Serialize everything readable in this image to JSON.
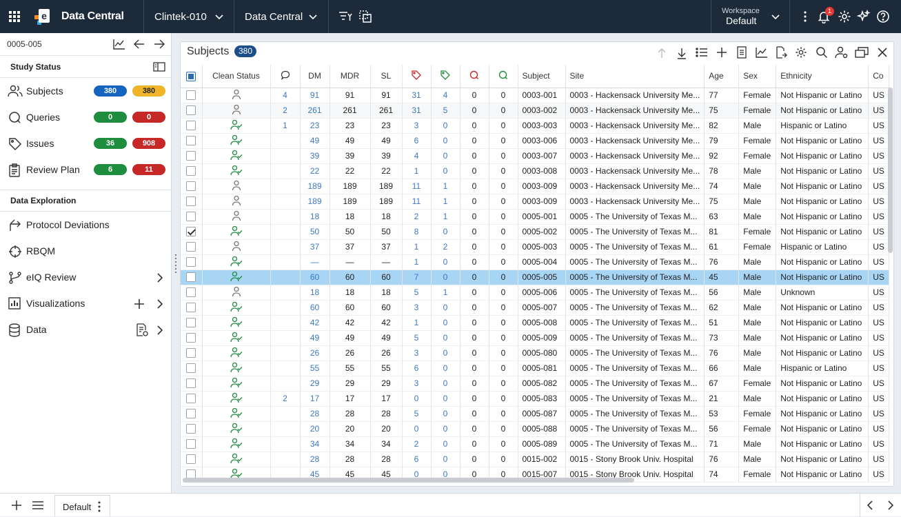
{
  "app": {
    "title": "Data Central"
  },
  "topbar": {
    "study": "Clintek-010",
    "module": "Data Central",
    "workspace_label": "Workspace",
    "workspace_value": "Default",
    "notif_count": "1"
  },
  "sidebar": {
    "subject_id": "0005-005",
    "study_status_title": "Study Status",
    "status_items": [
      {
        "label": "Subjects",
        "a": "380",
        "b": "380",
        "a_color": "#1565c0",
        "b_color": "#f0b429"
      },
      {
        "label": "Queries",
        "a": "0",
        "b": "0",
        "a_color": "#1e8e3e",
        "b_color": "#c62828"
      },
      {
        "label": "Issues",
        "a": "36",
        "b": "908",
        "a_color": "#1e8e3e",
        "b_color": "#c62828"
      },
      {
        "label": "Review Plan",
        "a": "6",
        "b": "11",
        "a_color": "#1e8e3e",
        "b_color": "#c62828"
      }
    ],
    "data_exploration_title": "Data Exploration",
    "explore_items": [
      "Protocol Deviations",
      "RBQM",
      "eIQ Review",
      "Visualizations",
      "Data"
    ]
  },
  "panel": {
    "title": "Subjects",
    "count": "380",
    "columns": [
      "Clean Status",
      "DM",
      "MDR",
      "SL",
      "Subject",
      "Site",
      "Age",
      "Sex",
      "Ethnicity",
      "Co"
    ],
    "rows": [
      {
        "chk": false,
        "clean": false,
        "cmt": "4",
        "dm": "91",
        "mdr": "91",
        "sl": "91",
        "tr": "31",
        "tg": "4",
        "qr": "0",
        "qg": "0",
        "subject": "0003-001",
        "site": "0003 - Hackensack University Me...",
        "age": "77",
        "sex": "Female",
        "eth": "Not Hispanic or Latino",
        "co": "US"
      },
      {
        "chk": false,
        "clean": false,
        "cmt": "2",
        "dm": "261",
        "mdr": "261",
        "sl": "261",
        "tr": "31",
        "tg": "5",
        "qr": "0",
        "qg": "0",
        "subject": "0003-002",
        "site": "0003 - Hackensack University Me...",
        "age": "75",
        "sex": "Female",
        "eth": "Not Hispanic or Latino",
        "co": "US"
      },
      {
        "chk": false,
        "clean": true,
        "cmt": "1",
        "dm": "23",
        "mdr": "23",
        "sl": "23",
        "tr": "3",
        "tg": "0",
        "qr": "0",
        "qg": "0",
        "subject": "0003-003",
        "site": "0003 - Hackensack University Me...",
        "age": "82",
        "sex": "Male",
        "eth": "Hispanic or Latino",
        "co": "US"
      },
      {
        "chk": false,
        "clean": true,
        "cmt": "",
        "dm": "49",
        "mdr": "49",
        "sl": "49",
        "tr": "6",
        "tg": "0",
        "qr": "0",
        "qg": "0",
        "subject": "0003-006",
        "site": "0003 - Hackensack University Me...",
        "age": "79",
        "sex": "Female",
        "eth": "Not Hispanic or Latino",
        "co": "US"
      },
      {
        "chk": false,
        "clean": true,
        "cmt": "",
        "dm": "39",
        "mdr": "39",
        "sl": "39",
        "tr": "4",
        "tg": "0",
        "qr": "0",
        "qg": "0",
        "subject": "0003-007",
        "site": "0003 - Hackensack University Me...",
        "age": "92",
        "sex": "Female",
        "eth": "Not Hispanic or Latino",
        "co": "US"
      },
      {
        "chk": false,
        "clean": true,
        "cmt": "",
        "dm": "22",
        "mdr": "22",
        "sl": "22",
        "tr": "1",
        "tg": "0",
        "qr": "0",
        "qg": "0",
        "subject": "0003-008",
        "site": "0003 - Hackensack University Me...",
        "age": "78",
        "sex": "Male",
        "eth": "Not Hispanic or Latino",
        "co": "US"
      },
      {
        "chk": false,
        "clean": false,
        "cmt": "",
        "dm": "189",
        "mdr": "189",
        "sl": "189",
        "tr": "11",
        "tg": "1",
        "qr": "0",
        "qg": "0",
        "subject": "0003-009",
        "site": "0003 - Hackensack University Me...",
        "age": "74",
        "sex": "Male",
        "eth": "Not Hispanic or Latino",
        "co": "US"
      },
      {
        "chk": false,
        "clean": false,
        "cmt": "",
        "dm": "189",
        "mdr": "189",
        "sl": "189",
        "tr": "11",
        "tg": "1",
        "qr": "0",
        "qg": "0",
        "subject": "0003-009",
        "site": "0003 - Hackensack University Me...",
        "age": "75",
        "sex": "Male",
        "eth": "Not Hispanic or Latino",
        "co": "US"
      },
      {
        "chk": false,
        "clean": false,
        "cmt": "",
        "dm": "18",
        "mdr": "18",
        "sl": "18",
        "tr": "2",
        "tg": "1",
        "qr": "0",
        "qg": "0",
        "subject": "0005-001",
        "site": "0005 - The University of Texas M...",
        "age": "63",
        "sex": "Male",
        "eth": "Not Hispanic or Latino",
        "co": "US"
      },
      {
        "chk": true,
        "clean": true,
        "cmt": "",
        "dm": "50",
        "mdr": "50",
        "sl": "50",
        "tr": "8",
        "tg": "0",
        "qr": "0",
        "qg": "0",
        "subject": "0005-002",
        "site": "0005 - The University of Texas M...",
        "age": "81",
        "sex": "Female",
        "eth": "Not Hispanic or Latino",
        "co": "US"
      },
      {
        "chk": false,
        "clean": false,
        "cmt": "",
        "dm": "37",
        "mdr": "37",
        "sl": "37",
        "tr": "1",
        "tg": "2",
        "qr": "0",
        "qg": "0",
        "subject": "0005-003",
        "site": "0005 - The University of Texas M...",
        "age": "61",
        "sex": "Female",
        "eth": "Hispanic or Latino",
        "co": "US"
      },
      {
        "chk": false,
        "clean": true,
        "cmt": "",
        "dm": "—",
        "mdr": "—",
        "sl": "—",
        "tr": "1",
        "tg": "0",
        "qr": "0",
        "qg": "0",
        "subject": "0005-004",
        "site": "0005 - The University of Texas M...",
        "age": "76",
        "sex": "Male",
        "eth": "Not Hispanic or Latino",
        "co": "US"
      },
      {
        "chk": false,
        "clean": true,
        "cmt": "",
        "dm": "60",
        "mdr": "60",
        "sl": "60",
        "tr": "7",
        "tg": "0",
        "qr": "0",
        "qg": "0",
        "subject": "0005-005",
        "site": "0005 - The University of Texas M...",
        "age": "45",
        "sex": "Male",
        "eth": "Not Hispanic or Latino",
        "co": "US",
        "sel": true
      },
      {
        "chk": false,
        "clean": false,
        "cmt": "",
        "dm": "18",
        "mdr": "18",
        "sl": "18",
        "tr": "5",
        "tg": "1",
        "qr": "0",
        "qg": "0",
        "subject": "0005-006",
        "site": "0005 - The University of Texas M...",
        "age": "56",
        "sex": "Male",
        "eth": "Unknown",
        "co": "US"
      },
      {
        "chk": false,
        "clean": true,
        "cmt": "",
        "dm": "60",
        "mdr": "60",
        "sl": "60",
        "tr": "3",
        "tg": "0",
        "qr": "0",
        "qg": "0",
        "subject": "0005-007",
        "site": "0005 - The University of Texas M...",
        "age": "62",
        "sex": "Male",
        "eth": "Not Hispanic or Latino",
        "co": "US"
      },
      {
        "chk": false,
        "clean": true,
        "cmt": "",
        "dm": "42",
        "mdr": "42",
        "sl": "42",
        "tr": "1",
        "tg": "0",
        "qr": "0",
        "qg": "0",
        "subject": "0005-008",
        "site": "0005 - The University of Texas M...",
        "age": "51",
        "sex": "Male",
        "eth": "Not Hispanic or Latino",
        "co": "US"
      },
      {
        "chk": false,
        "clean": true,
        "cmt": "",
        "dm": "49",
        "mdr": "49",
        "sl": "49",
        "tr": "5",
        "tg": "0",
        "qr": "0",
        "qg": "0",
        "subject": "0005-009",
        "site": "0005 - The University of Texas M...",
        "age": "73",
        "sex": "Male",
        "eth": "Not Hispanic or Latino",
        "co": "US"
      },
      {
        "chk": false,
        "clean": true,
        "cmt": "",
        "dm": "26",
        "mdr": "26",
        "sl": "26",
        "tr": "3",
        "tg": "0",
        "qr": "0",
        "qg": "0",
        "subject": "0005-080",
        "site": "0005 - The University of Texas M...",
        "age": "76",
        "sex": "Male",
        "eth": "Not Hispanic or Latino",
        "co": "US"
      },
      {
        "chk": false,
        "clean": true,
        "cmt": "",
        "dm": "55",
        "mdr": "55",
        "sl": "55",
        "tr": "6",
        "tg": "0",
        "qr": "0",
        "qg": "0",
        "subject": "0005-081",
        "site": "0005 - The University of Texas M...",
        "age": "66",
        "sex": "Male",
        "eth": "Hispanic or Latino",
        "co": "US"
      },
      {
        "chk": false,
        "clean": true,
        "cmt": "",
        "dm": "29",
        "mdr": "29",
        "sl": "29",
        "tr": "3",
        "tg": "0",
        "qr": "0",
        "qg": "0",
        "subject": "0005-082",
        "site": "0005 - The University of Texas M...",
        "age": "67",
        "sex": "Female",
        "eth": "Not Hispanic or Latino",
        "co": "US"
      },
      {
        "chk": false,
        "clean": true,
        "cmt": "2",
        "dm": "17",
        "mdr": "17",
        "sl": "17",
        "tr": "0",
        "tg": "0",
        "qr": "0",
        "qg": "0",
        "subject": "0005-083",
        "site": "0005 - The University of Texas M...",
        "age": "21",
        "sex": "Male",
        "eth": "Not Hispanic or Latino",
        "co": "US"
      },
      {
        "chk": false,
        "clean": true,
        "cmt": "",
        "dm": "28",
        "mdr": "28",
        "sl": "28",
        "tr": "5",
        "tg": "0",
        "qr": "0",
        "qg": "0",
        "subject": "0005-087",
        "site": "0005 - The University of Texas M...",
        "age": "53",
        "sex": "Female",
        "eth": "Not Hispanic or Latino",
        "co": "US"
      },
      {
        "chk": false,
        "clean": true,
        "cmt": "",
        "dm": "20",
        "mdr": "20",
        "sl": "20",
        "tr": "0",
        "tg": "0",
        "qr": "0",
        "qg": "0",
        "subject": "0005-088",
        "site": "0005 - The University of Texas M...",
        "age": "56",
        "sex": "Female",
        "eth": "Not Hispanic or Latino",
        "co": "US"
      },
      {
        "chk": false,
        "clean": true,
        "cmt": "",
        "dm": "34",
        "mdr": "34",
        "sl": "34",
        "tr": "2",
        "tg": "0",
        "qr": "0",
        "qg": "0",
        "subject": "0005-089",
        "site": "0005 - The University of Texas M...",
        "age": "71",
        "sex": "Male",
        "eth": "Not Hispanic or Latino",
        "co": "US"
      },
      {
        "chk": false,
        "clean": true,
        "cmt": "",
        "dm": "28",
        "mdr": "28",
        "sl": "28",
        "tr": "6",
        "tg": "0",
        "qr": "0",
        "qg": "0",
        "subject": "0015-002",
        "site": "0015 - Stony Brook Univ. Hospital",
        "age": "76",
        "sex": "Male",
        "eth": "Not Hispanic or Latino",
        "co": "US"
      },
      {
        "chk": false,
        "clean": true,
        "cmt": "",
        "dm": "45",
        "mdr": "45",
        "sl": "45",
        "tr": "0",
        "tg": "0",
        "qr": "0",
        "qg": "0",
        "subject": "0015-007",
        "site": "0015 - Stony Brook Univ. Hospital",
        "age": "74",
        "sex": "Female",
        "eth": "Not Hispanic or Latino",
        "co": "US"
      }
    ]
  },
  "bottombar": {
    "tab_label": "Default"
  }
}
